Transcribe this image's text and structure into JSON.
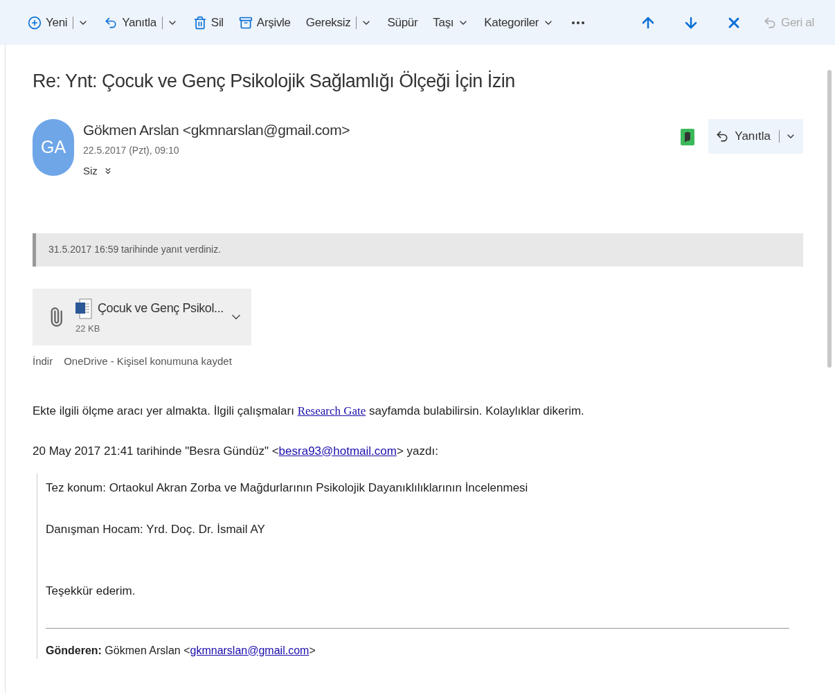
{
  "toolbar": {
    "items": [
      {
        "kind": "new",
        "label": "Yeni",
        "split": true,
        "dropdown": true,
        "disabled": false
      },
      {
        "kind": "reply",
        "label": "Yanıtla",
        "split": true,
        "dropdown": true,
        "disabled": false
      },
      {
        "kind": "delete",
        "label": "Sil",
        "split": false,
        "dropdown": false,
        "disabled": false
      },
      {
        "kind": "archive",
        "label": "Arşivle",
        "split": false,
        "dropdown": false,
        "disabled": false
      },
      {
        "kind": "text",
        "label": "Gereksiz",
        "split": true,
        "dropdown": true,
        "disabled": false
      },
      {
        "kind": "text",
        "label": "Süpür",
        "split": false,
        "dropdown": false,
        "disabled": false
      },
      {
        "kind": "text",
        "label": "Taşı",
        "split": false,
        "dropdown": true,
        "disabled": false
      },
      {
        "kind": "text",
        "label": "Kategoriler",
        "split": false,
        "dropdown": true,
        "disabled": false
      },
      {
        "kind": "more",
        "disabled": false
      }
    ],
    "right": [
      {
        "kind": "up",
        "disabled": false
      },
      {
        "kind": "down",
        "disabled": false
      },
      {
        "kind": "close",
        "disabled": false
      },
      {
        "kind": "undo",
        "label": "Geri al",
        "disabled": true
      }
    ]
  },
  "message": {
    "subject": "Re: Ynt: Çocuk ve Genç Psikolojik Sağlamlığı Ölçeği İçin İzin",
    "avatar": "GA",
    "sender": "Gökmen Arslan <gkmnarslan@gmail.com>",
    "date": "22.5.2017 (Pzt), 09:10",
    "to": "Siz",
    "reply_button": {
      "label": "Yanıtla"
    },
    "notice": "31.5.2017 16:59 tarihinde yanıt verdiniz.",
    "attachment": {
      "name": "Çocuk ve Genç Psikol...",
      "size": "22 KB",
      "actions": [
        "İndir",
        "OneDrive - Kişisel konumuna kaydet"
      ]
    },
    "body": [
      {
        "before": "Ekte ilgili ölçme aracı yer almakta. İlgili çalışmaları  ",
        "link": "Research Gate",
        "after": " sayfamda bulabilirsin. Kolaylıklar dikerim.",
        "serif_link": true
      },
      {
        "before": "20 May 2017 21:41 tarihinde \"Besra Gündüz\" <",
        "link": "besra93@hotmail.com",
        "after": "> yazdı:",
        "serif_link": false
      }
    ],
    "quote": {
      "lines": [
        "Tez konum:  Ortaokul Akran Zorba ve Mağdurlarının Psikolojik Dayanıklılıklarının İncelenmesi",
        "Danışman Hocam: Yrd. Doç. Dr. İsmail AY",
        "Teşekkür ederim."
      ],
      "from": {
        "before": "**Gönderen:** Gökmen Arslan <",
        "link": "gkmnarslan@gmail.com",
        "after": ">"
      }
    }
  }
}
